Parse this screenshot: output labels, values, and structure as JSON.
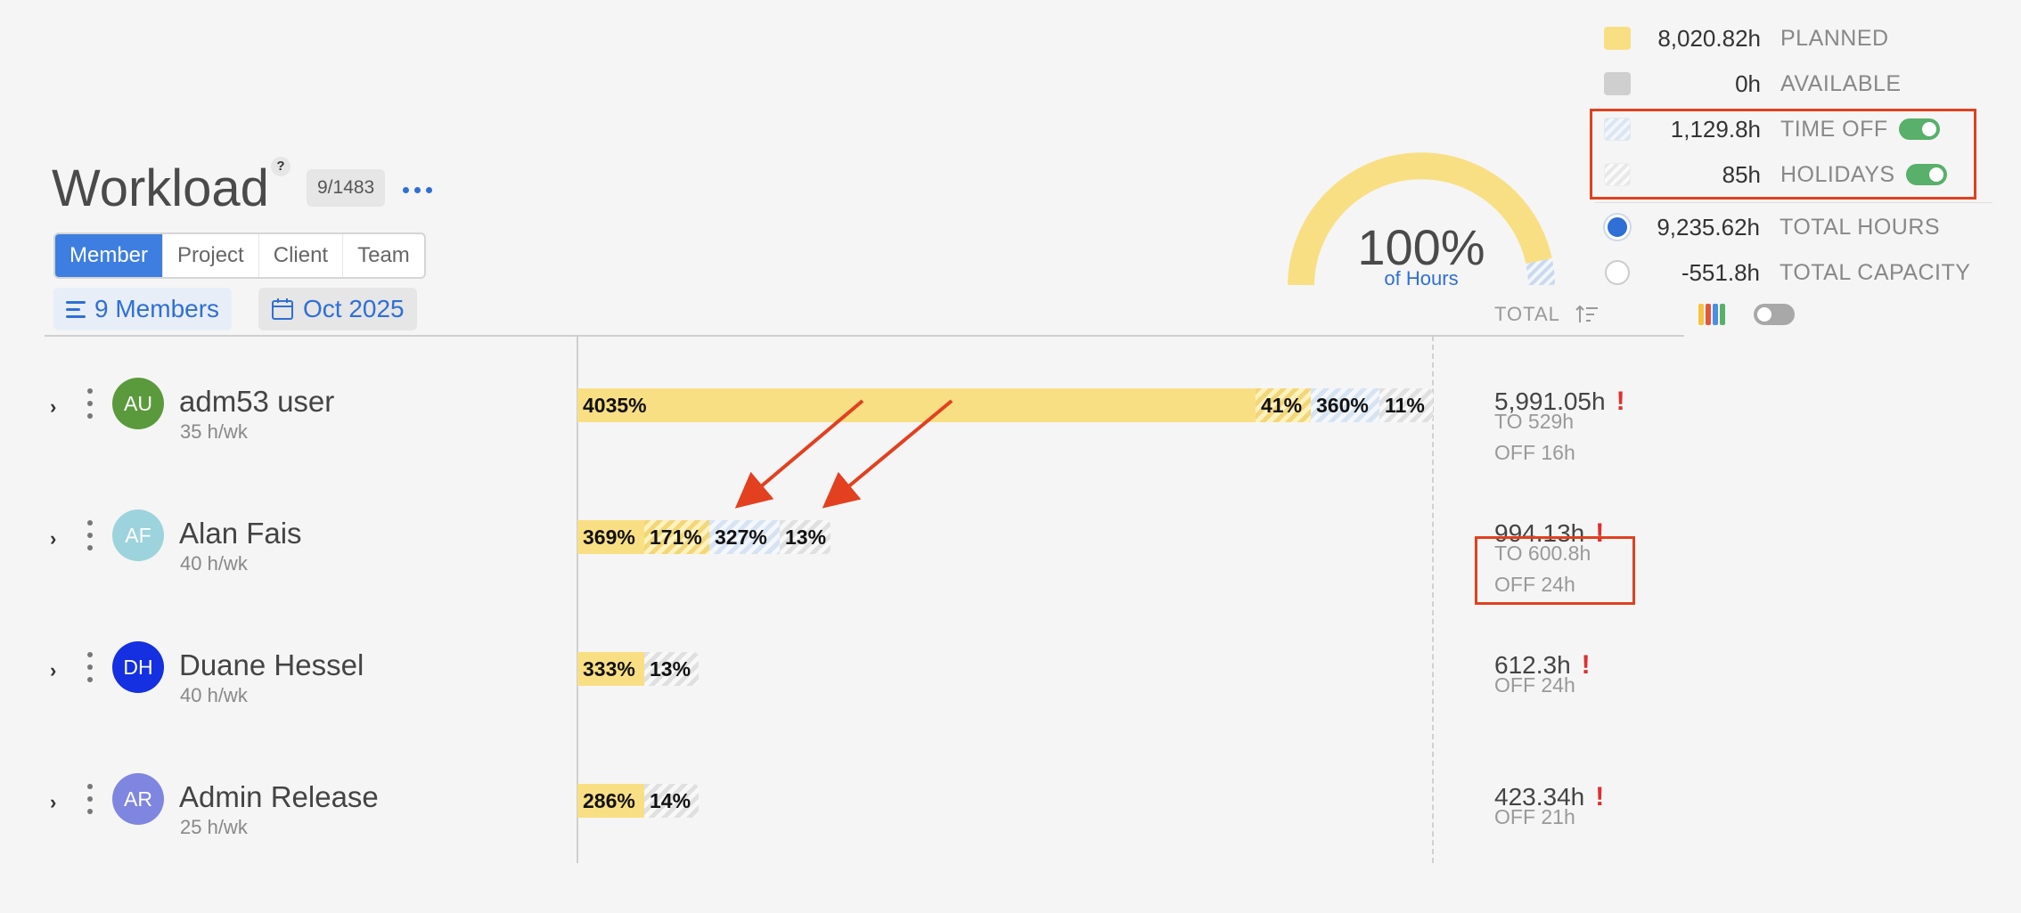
{
  "header": {
    "title": "Workload",
    "help": "?",
    "count_badge": "9/1483"
  },
  "view_tabs": [
    "Member",
    "Project",
    "Client",
    "Team"
  ],
  "filters": {
    "members": "9 Members",
    "date": "Oct 2025"
  },
  "gauge": {
    "percent": "100%",
    "label": "of Hours"
  },
  "total_header": "TOTAL",
  "legend": {
    "planned": {
      "value": "8,020.82h",
      "label": "PLANNED"
    },
    "available": {
      "value": "0h",
      "label": "AVAILABLE"
    },
    "time_off": {
      "value": "1,129.8h",
      "label": "TIME OFF",
      "enabled": true
    },
    "holidays": {
      "value": "85h",
      "label": "HOLIDAYS",
      "enabled": true
    },
    "total_hours": {
      "value": "9,235.62h",
      "label": "TOTAL HOURS"
    },
    "total_capacity": {
      "value": "-551.8h",
      "label": "TOTAL CAPACITY"
    }
  },
  "members": [
    {
      "initials": "AU",
      "name": "adm53 user",
      "rate": "35 h/wk",
      "avatar_color": "#5a9a3c",
      "segments": [
        "4035%",
        "41%",
        "360%",
        "11%"
      ],
      "total": "5,991.05h",
      "warning": "!",
      "time_off": "TO 529h",
      "off": "OFF 16h"
    },
    {
      "initials": "AF",
      "name": "Alan Fais",
      "rate": "40 h/wk",
      "avatar_color": "#9dd3dd",
      "segments": [
        "369%",
        "171%",
        "327%",
        "13%"
      ],
      "total": "994.13h",
      "warning": "!",
      "time_off": "TO 600.8h",
      "off": "OFF 24h"
    },
    {
      "initials": "DH",
      "name": "Duane Hessel",
      "rate": "40 h/wk",
      "avatar_color": "#1430e0",
      "segments": [
        "333%",
        "13%"
      ],
      "total": "612.3h",
      "warning": "!",
      "off": "OFF 24h"
    },
    {
      "initials": "AR",
      "name": "Admin Release",
      "rate": "25 h/wk",
      "avatar_color": "#7f86e0",
      "segments": [
        "286%",
        "14%"
      ],
      "total": "423.34h",
      "warning": "!",
      "off": "OFF 21h"
    }
  ],
  "colors": {
    "accent": "#2f6fd6",
    "planned": "#f9df84",
    "annotation": "#e2401f",
    "warning": "#e02f2f",
    "toggle_on": "#58b06a"
  }
}
